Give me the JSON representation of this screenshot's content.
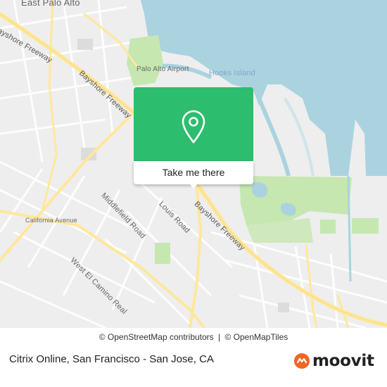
{
  "map": {
    "labels": {
      "east_palo_alto": "East Palo Alto",
      "palo_alto_airport": "Palo Alto Airport",
      "hooks_island": "Hooks Island",
      "bayshore_freeway_1": "Bayshore Freeway",
      "bayshore_freeway_2": "Bayshore Freeway",
      "bayshore_freeway_3": "Bayshore Freeway",
      "middlefield_road": "Middlefield Road",
      "louis_road": "Louis Road",
      "california_avenue": "California Avenue",
      "west_el_camino_real": "West El Camino Real"
    },
    "colors": {
      "water": "#aad3df",
      "land": "#eeeeee",
      "park": "#c6e7b0",
      "road_major": "#ffe79a",
      "road_minor": "#ffffff",
      "marker_green": "#2dbd6e"
    }
  },
  "marker": {
    "pin_icon": "location-pin-icon",
    "label": "Take me there"
  },
  "attribution": {
    "osm": "© OpenStreetMap contributors",
    "separator": "|",
    "omt": "© OpenMapTiles"
  },
  "footer": {
    "title": "Citrix Online, San Francisco - San Jose, CA",
    "brand": "moovit",
    "brand_icon": "moovit-logo-icon",
    "brand_color": "#f26522"
  }
}
